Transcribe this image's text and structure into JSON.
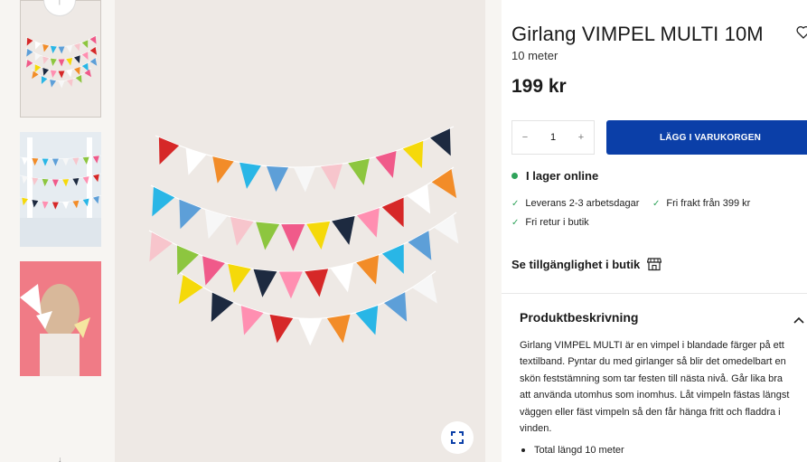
{
  "product": {
    "title": "Girlang VIMPEL MULTI 10M",
    "subtitle": "10 meter",
    "price": "199 kr"
  },
  "cart": {
    "decrement": "−",
    "quantity": "1",
    "increment": "+",
    "add_label": "LÄGG I VARUKORGEN"
  },
  "stock": {
    "label": "I lager online",
    "color": "#2fa35a"
  },
  "usps": [
    "Leverans 2-3 arbetsdagar",
    "Fri frakt från 399 kr",
    "Fri retur i butik"
  ],
  "availability": {
    "label": "Se tillgänglighet i butik"
  },
  "description": {
    "heading": "Produktbeskrivning",
    "text": "Girlang VIMPEL MULTI är en vimpel i blandade färger på ett textilband. Pyntar du med girlanger så blir det omedelbart en skön feststämning som tar festen till nästa nivå. Går lika bra att använda utomhus som inomhus. Låt vimpeln fästas längst väggen eller fäst vimpeln så den får hänga fritt och fladdra i vinden.",
    "bullets": [
      "Total längd 10 meter"
    ]
  },
  "colors": {
    "accent": "#0b3fa8",
    "in_stock": "#2fa35a"
  },
  "icons": [
    "heart-icon",
    "store-icon",
    "chevron-up-icon",
    "fullscreen-icon",
    "check-icon",
    "arrow-up-icon"
  ]
}
